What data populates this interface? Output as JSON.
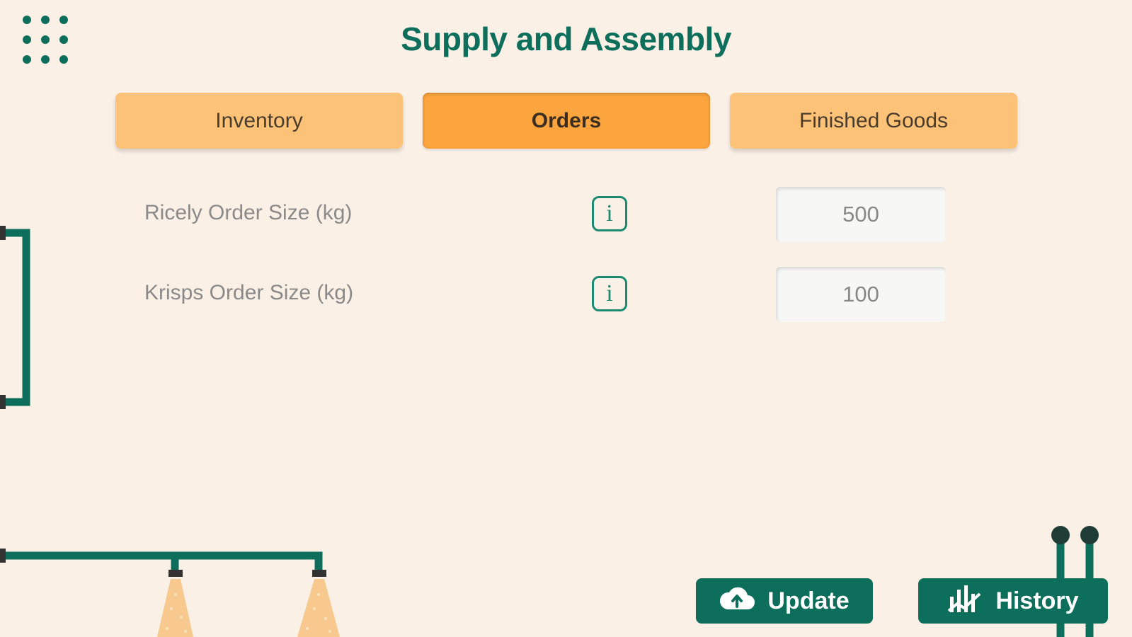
{
  "header": {
    "title": "Supply and Assembly",
    "menu_icon": "grid-menu-icon"
  },
  "tabs": [
    {
      "label": "Inventory",
      "active": false
    },
    {
      "label": "Orders",
      "active": true
    },
    {
      "label": "Finished Goods",
      "active": false
    }
  ],
  "orders": [
    {
      "label": "Ricely Order Size (kg)",
      "value": "500",
      "info_icon": "info-icon"
    },
    {
      "label": "Krisps Order Size (kg)",
      "value": "100",
      "info_icon": "info-icon"
    }
  ],
  "actions": {
    "update_label": "Update",
    "update_icon": "cloud-upload-icon",
    "history_label": "History",
    "history_icon": "chart-icon"
  },
  "colors": {
    "background": "#fbf0e6",
    "brand_green": "#0e6e5c",
    "tab_inactive": "#fcc278",
    "tab_active": "#fca53e"
  }
}
